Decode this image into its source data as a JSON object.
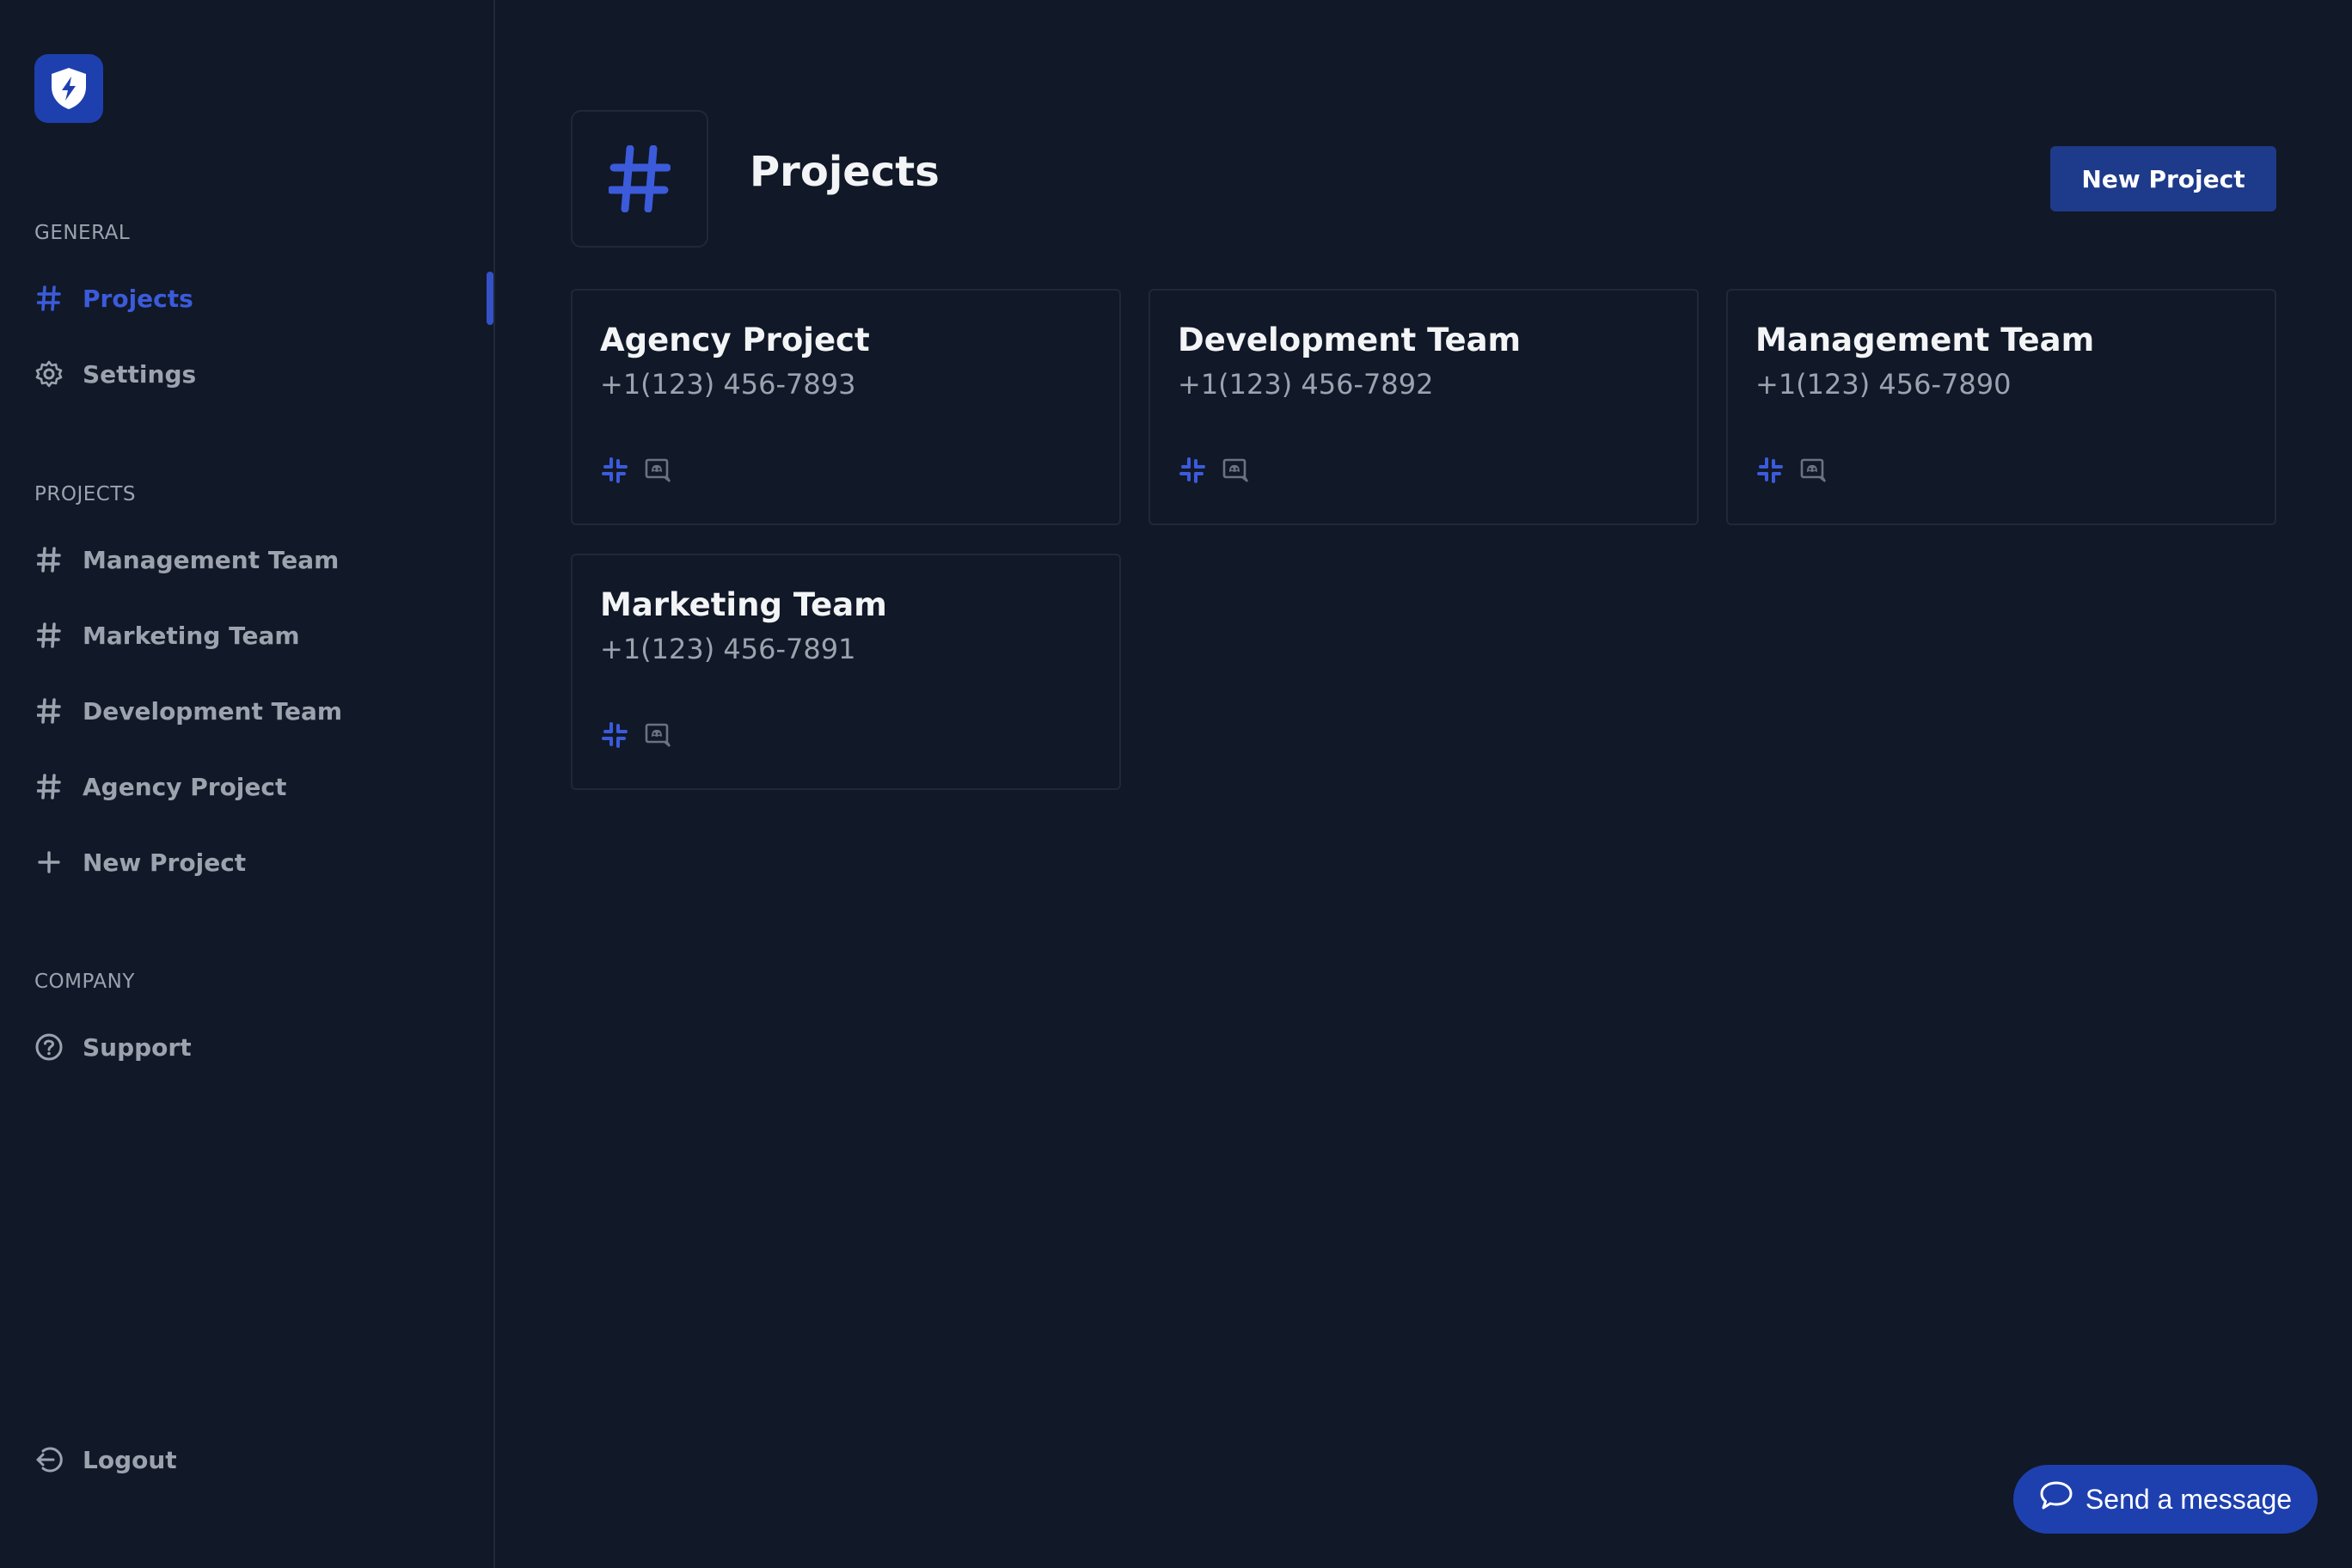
{
  "sidebar": {
    "general_label": "GENERAL",
    "general_items": [
      {
        "label": "Projects",
        "icon": "hash-icon",
        "active": true
      },
      {
        "label": "Settings",
        "icon": "gear-icon"
      }
    ],
    "projects_label": "PROJECTS",
    "project_items": [
      {
        "label": "Management Team",
        "icon": "hash-icon"
      },
      {
        "label": "Marketing Team",
        "icon": "hash-icon"
      },
      {
        "label": "Development Team",
        "icon": "hash-icon"
      },
      {
        "label": "Agency Project",
        "icon": "hash-icon"
      },
      {
        "label": "New Project",
        "icon": "plus-icon"
      }
    ],
    "company_label": "COMPANY",
    "company_items": [
      {
        "label": "Support",
        "icon": "help-circle-icon"
      }
    ],
    "logout_label": "Logout"
  },
  "header": {
    "title": "Projects",
    "new_project_label": "New Project"
  },
  "cards": [
    {
      "name": "Agency Project",
      "phone": "+1(123) 456-7893"
    },
    {
      "name": "Development Team",
      "phone": "+1(123) 456-7892"
    },
    {
      "name": "Management Team",
      "phone": "+1(123) 456-7890"
    },
    {
      "name": "Marketing Team",
      "phone": "+1(123) 456-7891"
    }
  ],
  "chat": {
    "send_label": "Send a message"
  },
  "colors": {
    "background": "#111827",
    "accent": "#3b5bdb",
    "button": "#1e3a8a",
    "border": "#1f2937",
    "muted_text": "#9ca3af"
  }
}
